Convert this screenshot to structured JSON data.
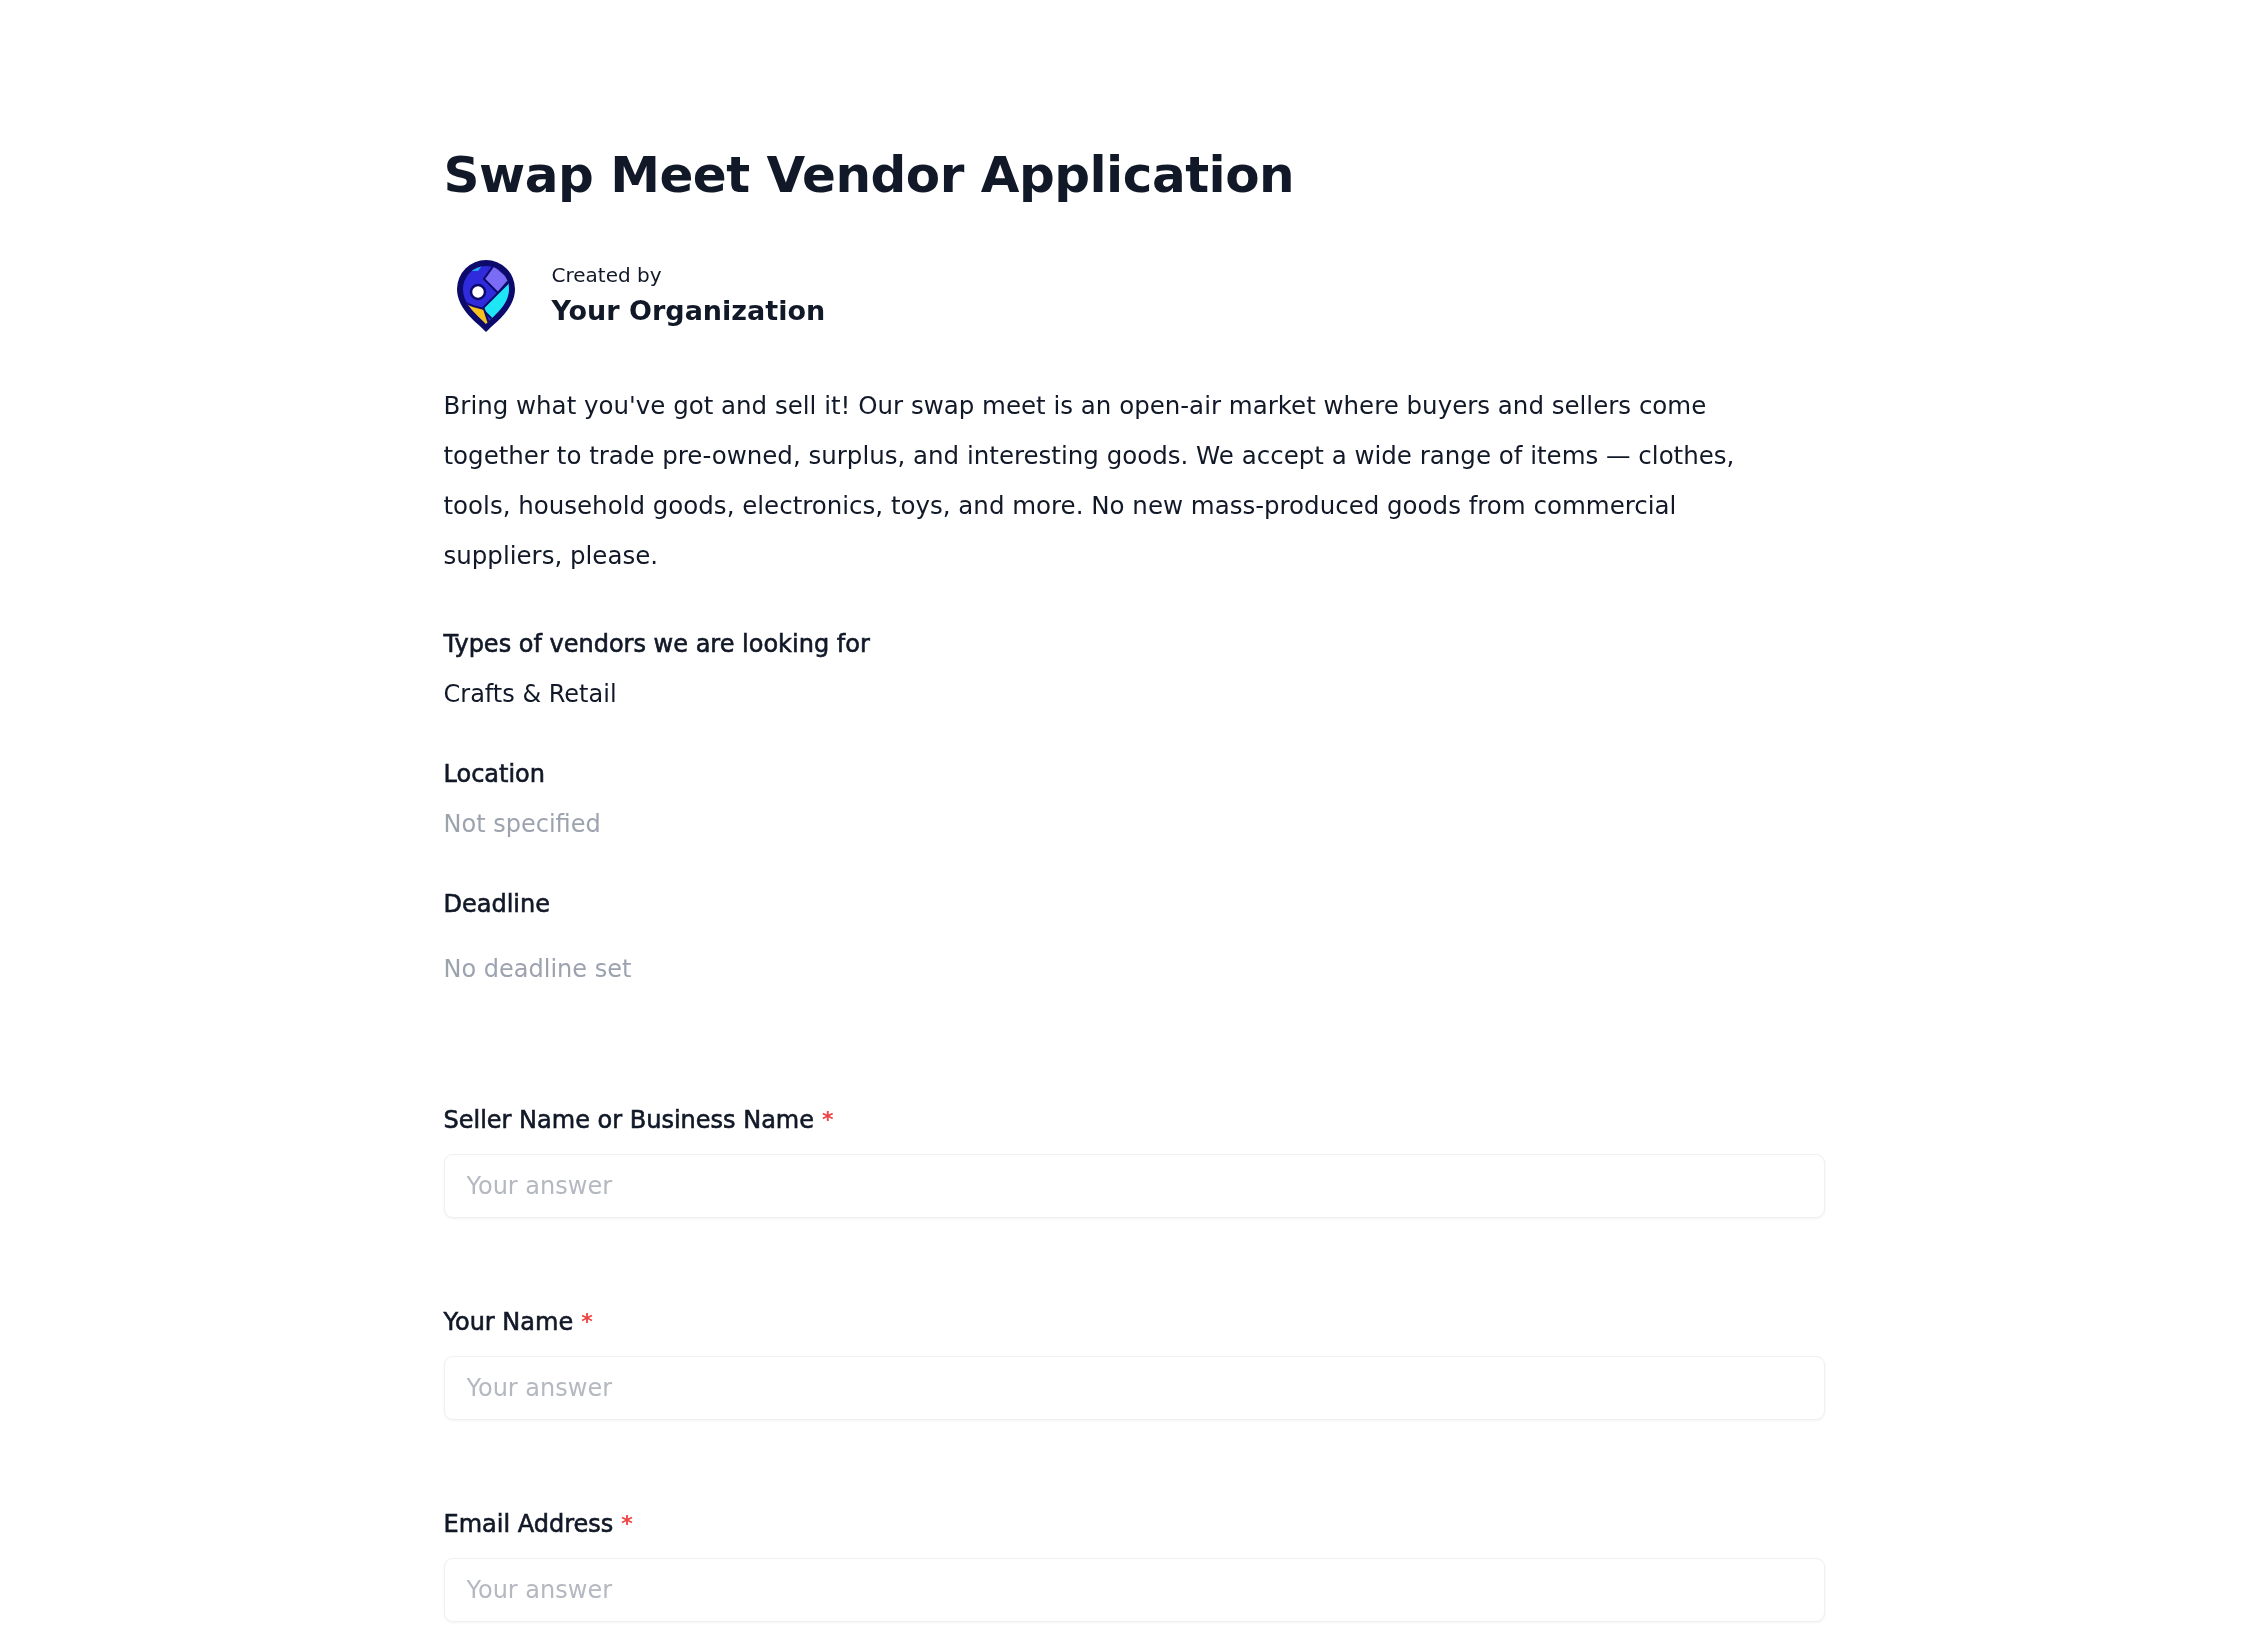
{
  "title": "Swap Meet Vendor Application",
  "creator": {
    "caption": "Created by",
    "name": "Your Organization"
  },
  "description": "Bring what you've got and sell it! Our swap meet is an open-air market where buyers and sellers come together to trade pre-owned, surplus, and interesting goods. We accept a wide range of items — clothes, tools, household goods, electronics, toys, and more. No new mass-produced goods from commercial suppliers, please.",
  "details": [
    {
      "kind": "text",
      "label": "Types of vendors we are looking for",
      "value": "Crafts & Retail",
      "empty": false
    },
    {
      "kind": "text",
      "label": "Location",
      "value": "Not specified",
      "empty": true
    },
    {
      "kind": "date",
      "label": "Deadline",
      "value": "No deadline set",
      "empty": true
    }
  ],
  "questions": [
    {
      "label": "Seller Name or Business Name",
      "required": true,
      "required_mark": "*",
      "placeholder": "Your answer"
    },
    {
      "label": "Your Name",
      "required": true,
      "required_mark": "*",
      "placeholder": "Your answer"
    },
    {
      "label": "Email Address",
      "required": true,
      "required_mark": "*",
      "placeholder": "Your answer"
    }
  ]
}
